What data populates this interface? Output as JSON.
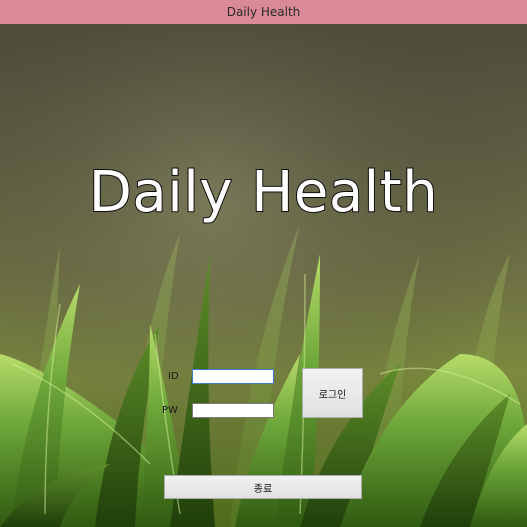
{
  "window": {
    "title": "Daily Health"
  },
  "hero": {
    "title": "Daily Health"
  },
  "login_form": {
    "id_label": "ID",
    "id_value": "",
    "pw_label": "PW",
    "pw_value": "",
    "login_button": "로그인",
    "exit_button": "종료"
  },
  "colors": {
    "titlebar": "#d98a96",
    "focus_border": "#3d7bc6",
    "background_top": "#5a5a3a",
    "grass": "#6ea83a"
  }
}
